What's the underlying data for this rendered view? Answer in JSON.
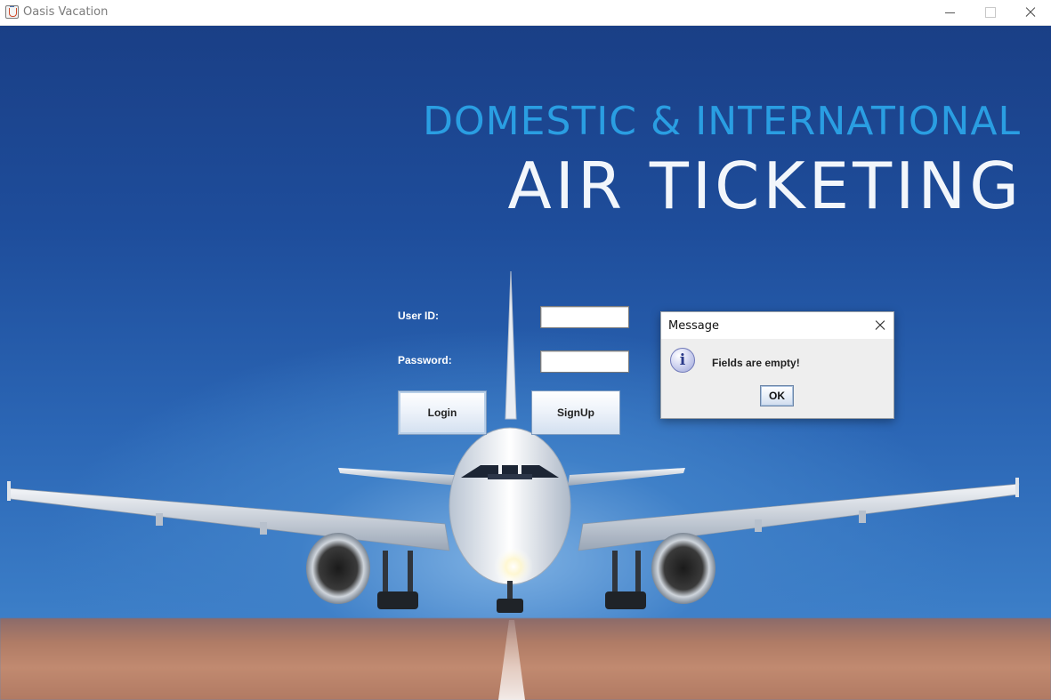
{
  "window": {
    "title": "Oasis Vacation"
  },
  "banner": {
    "line1": "DOMESTIC & INTERNATIONAL",
    "line2": "AIR TICKETING"
  },
  "form": {
    "userid_label": "User ID:",
    "userid_value": "",
    "password_label": "Password:",
    "password_value": "",
    "login_label": "Login",
    "signup_label": "SignUp"
  },
  "dialog": {
    "title": "Message",
    "message": "Fields are empty!",
    "ok_label": "OK",
    "icon": "info-icon"
  },
  "colors": {
    "sky": "#1e4d9b",
    "banner_line1": "#2a9ee2",
    "banner_line2": "#f2f6fb"
  }
}
